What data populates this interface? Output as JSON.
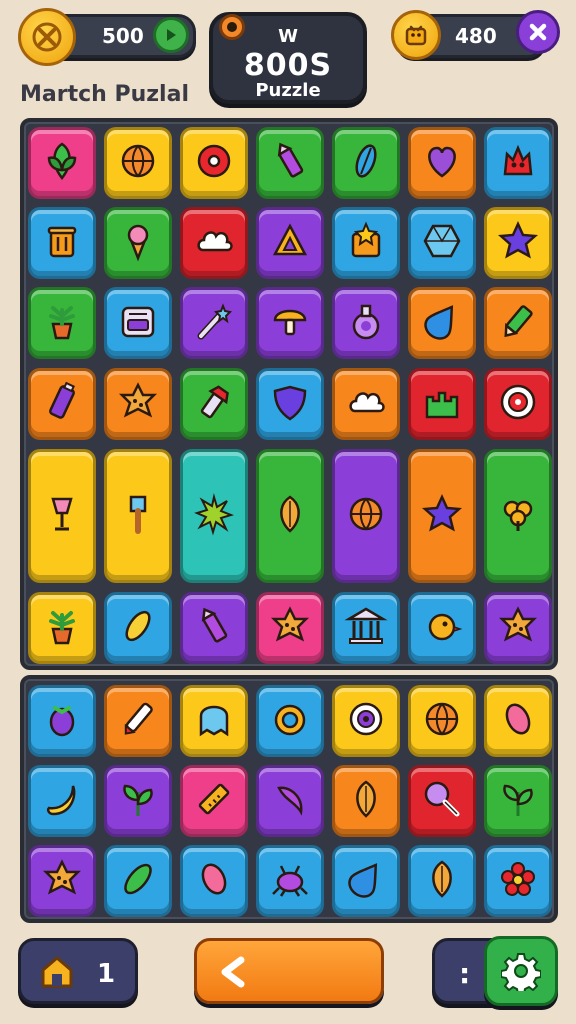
{
  "hud": {
    "left_coins": "500",
    "right_coins": "480",
    "title_small": "W",
    "title_big": "800S",
    "title_sub": "Puzzle",
    "game_name": "Martch Puzlal"
  },
  "bottom_bar": {
    "home_count": "1",
    "right_label": ":"
  },
  "colors": {
    "background": "#ece0cc",
    "board": "#343844",
    "pink": "#ef3f8a",
    "yellow": "#fcc91a",
    "orange": "#f7861c",
    "green": "#38b63c",
    "blue": "#2fa5e3",
    "purple": "#8b3fd8",
    "red": "#e0252e",
    "teal": "#2ec3b7"
  },
  "board_top": {
    "rows": [
      [
        {
          "color": "pink",
          "icon": "leaf-icon"
        },
        {
          "color": "yellow",
          "icon": "ball-icon"
        },
        {
          "color": "yellow",
          "icon": "donut-icon"
        },
        {
          "color": "green",
          "icon": "crayon-icon"
        },
        {
          "color": "green",
          "icon": "feather-icon"
        },
        {
          "color": "orange",
          "icon": "heart-icon"
        },
        {
          "color": "blue",
          "icon": "monster-icon"
        }
      ],
      [
        {
          "color": "blue",
          "icon": "trash-icon"
        },
        {
          "color": "green",
          "icon": "ice-cream-icon"
        },
        {
          "color": "red",
          "icon": "cloud-icon"
        },
        {
          "color": "purple",
          "icon": "triangle-icon"
        },
        {
          "color": "blue",
          "icon": "star-box-icon"
        },
        {
          "color": "blue",
          "icon": "gem-icon"
        },
        {
          "color": "yellow",
          "icon": "star-icon"
        }
      ],
      [
        {
          "color": "green",
          "icon": "plant-icon"
        },
        {
          "color": "blue",
          "icon": "radio-icon"
        },
        {
          "color": "purple",
          "icon": "wand-icon"
        },
        {
          "color": "purple",
          "icon": "mushroom-icon"
        },
        {
          "color": "purple",
          "icon": "potion-icon"
        },
        {
          "color": "orange",
          "icon": "drop-icon"
        },
        {
          "color": "orange",
          "icon": "pencil-icon"
        }
      ],
      [
        {
          "color": "orange",
          "icon": "battery-icon"
        },
        {
          "color": "orange",
          "icon": "cookie-icon"
        },
        {
          "color": "green",
          "icon": "flashlight-icon"
        },
        {
          "color": "blue",
          "icon": "shield-icon"
        },
        {
          "color": "orange",
          "icon": "cloud-icon"
        },
        {
          "color": "red",
          "icon": "castle-icon"
        },
        {
          "color": "red",
          "icon": "target-icon"
        }
      ],
      [
        {
          "color": "yellow",
          "icon": "lamp-icon",
          "tall": true
        },
        {
          "color": "yellow",
          "icon": "brush-icon",
          "tall": true
        },
        {
          "color": "teal",
          "icon": "splat-icon",
          "tall": true
        },
        {
          "color": "green",
          "icon": "leaf-drop-icon",
          "tall": true
        },
        {
          "color": "purple",
          "icon": "ball-icon",
          "tall": true
        },
        {
          "color": "orange",
          "icon": "star-icon",
          "tall": true
        },
        {
          "color": "green",
          "icon": "clover-icon",
          "tall": true
        }
      ],
      [
        {
          "color": "yellow",
          "icon": "plant-icon"
        },
        {
          "color": "blue",
          "icon": "corn-icon"
        },
        {
          "color": "purple",
          "icon": "crayon-icon"
        },
        {
          "color": "pink",
          "icon": "cookie-icon"
        },
        {
          "color": "blue",
          "icon": "temple-icon"
        },
        {
          "color": "blue",
          "icon": "bird-icon"
        },
        {
          "color": "purple",
          "icon": "cookie-icon"
        }
      ]
    ]
  },
  "board_bottom": {
    "rows": [
      [
        {
          "color": "blue",
          "icon": "eggplant-icon"
        },
        {
          "color": "orange",
          "icon": "pen-icon"
        },
        {
          "color": "yellow",
          "icon": "ghost-icon"
        },
        {
          "color": "blue",
          "icon": "ring-icon"
        },
        {
          "color": "yellow",
          "icon": "eye-icon"
        },
        {
          "color": "yellow",
          "icon": "ball-icon"
        },
        {
          "color": "yellow",
          "icon": "bean-icon"
        }
      ],
      [
        {
          "color": "blue",
          "icon": "banana-icon"
        },
        {
          "color": "purple",
          "icon": "sprout-icon"
        },
        {
          "color": "pink",
          "icon": "ruler-icon"
        },
        {
          "color": "purple",
          "icon": "pepper-icon"
        },
        {
          "color": "orange",
          "icon": "leaf-drop-icon"
        },
        {
          "color": "red",
          "icon": "lollipop-icon"
        },
        {
          "color": "green",
          "icon": "sprout-icon"
        }
      ],
      [
        {
          "color": "purple",
          "icon": "cookie-icon"
        },
        {
          "color": "blue",
          "icon": "pickle-icon"
        },
        {
          "color": "blue",
          "icon": "bean-icon"
        },
        {
          "color": "blue",
          "icon": "bug-icon"
        },
        {
          "color": "blue",
          "icon": "drop-icon"
        },
        {
          "color": "blue",
          "icon": "leaf-drop-icon"
        },
        {
          "color": "blue",
          "icon": "flower-icon"
        }
      ]
    ]
  }
}
